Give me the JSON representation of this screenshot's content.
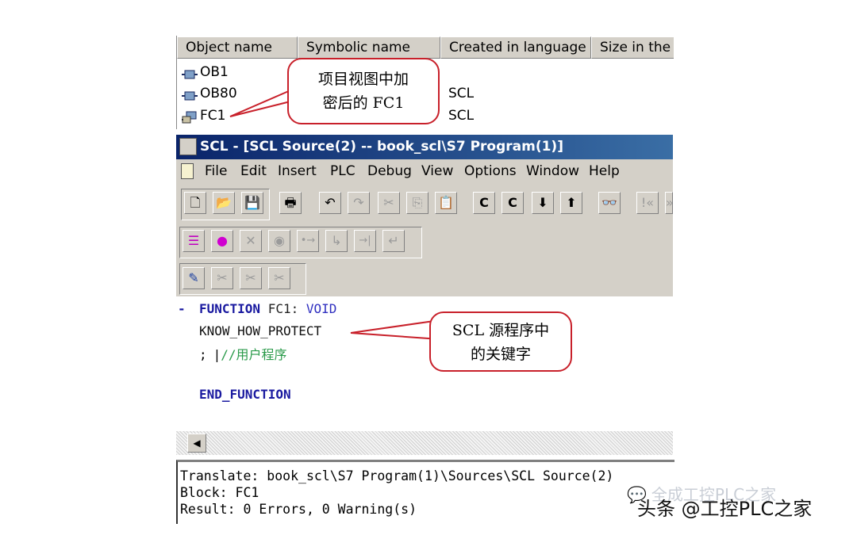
{
  "object_list": {
    "columns": [
      "Object name",
      "Symbolic name",
      "Created in language",
      "Size in the w"
    ],
    "rows": [
      {
        "name": "OB1",
        "language": ""
      },
      {
        "name": "OB80",
        "language": "SCL"
      },
      {
        "name": "FC1",
        "language": "SCL"
      }
    ]
  },
  "callouts": {
    "project_view": [
      "项目视图中加",
      "密后的 FC1"
    ],
    "keyword": [
      "SCL 源程序中",
      "的关键字"
    ]
  },
  "window": {
    "title": "SCL  - [SCL Source(2) -- book_scl\\S7 Program(1)]",
    "menu": [
      "File",
      "Edit",
      "Insert",
      "PLC",
      "Debug",
      "View",
      "Options",
      "Window",
      "Help"
    ]
  },
  "toolbars": {
    "row1": [
      {
        "name": "new-icon",
        "glyph": "🗋"
      },
      {
        "name": "open-icon",
        "glyph": "📂"
      },
      {
        "name": "save-icon",
        "glyph": "💾"
      },
      {
        "name": "print-icon",
        "glyph": "🖶"
      },
      {
        "name": "undo-icon",
        "glyph": "↶"
      },
      {
        "name": "redo-icon",
        "glyph": "↷"
      },
      {
        "name": "cut-icon",
        "glyph": "✂"
      },
      {
        "name": "copy-icon",
        "glyph": "⎘"
      },
      {
        "name": "paste-icon",
        "glyph": "📋"
      },
      {
        "name": "compile-icon",
        "glyph": "C"
      },
      {
        "name": "compile-all-icon",
        "glyph": "C"
      },
      {
        "name": "download-icon",
        "glyph": "⬇"
      },
      {
        "name": "upload-icon",
        "glyph": "⬆"
      },
      {
        "name": "monitor-icon",
        "glyph": "👓"
      },
      {
        "name": "go-start-icon",
        "glyph": "!«"
      },
      {
        "name": "go-end-icon",
        "glyph": "»"
      }
    ],
    "row2": [
      {
        "name": "breakpoint-list-icon",
        "glyph": "☰"
      },
      {
        "name": "set-breakpoint-icon",
        "glyph": "●"
      },
      {
        "name": "delete-breakpoints-icon",
        "glyph": "✕"
      },
      {
        "name": "activate-breakpoint-icon",
        "glyph": "◉"
      },
      {
        "name": "next-breakpoint-icon",
        "glyph": "•→"
      },
      {
        "name": "step-over-icon",
        "glyph": "↳"
      },
      {
        "name": "step-into-icon",
        "glyph": "→|"
      },
      {
        "name": "run-to-cursor-icon",
        "glyph": "↵"
      }
    ],
    "row3": [
      {
        "name": "bookmark-icon",
        "glyph": "✎"
      },
      {
        "name": "bookmark-next-icon",
        "glyph": "✂"
      },
      {
        "name": "bookmark-prev-icon",
        "glyph": "✂"
      },
      {
        "name": "bookmark-clear-icon",
        "glyph": "✂"
      }
    ]
  },
  "editor": {
    "collapse_marker": "-",
    "function_kw": "FUNCTION",
    "fc_name": " FC1:",
    "return_type": " VOID",
    "protect_kw": "KNOW_HOW_PROTECT",
    "stmt_prefix": ";",
    "comment": "//用户程序",
    "end_kw": "END_FUNCTION"
  },
  "output": {
    "lines": [
      "Translate: book_scl\\S7 Program(1)\\Sources\\SCL Source(2)",
      "Block: FC1",
      "Result: 0 Errors, 0 Warning(s)"
    ]
  },
  "watermark": {
    "line1": "全成工控PLC之家",
    "line2": "头条 @工控PLC之家"
  }
}
